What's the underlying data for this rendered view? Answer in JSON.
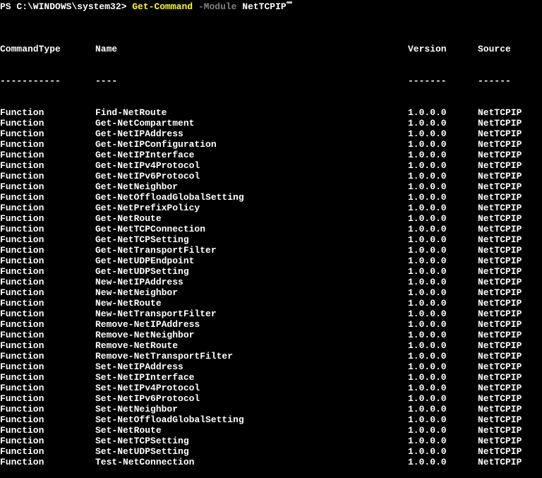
{
  "prompt": {
    "prefix": "PS C:\\WINDOWS\\system32> ",
    "command": "Get-Command",
    "flag": " -Module ",
    "arg": "NetTCPIP"
  },
  "headers": {
    "commandType": "CommandType",
    "name": "Name",
    "version": "Version",
    "source": "Source"
  },
  "separators": {
    "commandType": "-----------",
    "name": "----",
    "version": "-------",
    "source": "------"
  },
  "rows": [
    {
      "type": "Function",
      "name": "Find-NetRoute",
      "version": "1.0.0.0",
      "source": "NetTCPIP"
    },
    {
      "type": "Function",
      "name": "Get-NetCompartment",
      "version": "1.0.0.0",
      "source": "NetTCPIP"
    },
    {
      "type": "Function",
      "name": "Get-NetIPAddress",
      "version": "1.0.0.0",
      "source": "NetTCPIP"
    },
    {
      "type": "Function",
      "name": "Get-NetIPConfiguration",
      "version": "1.0.0.0",
      "source": "NetTCPIP"
    },
    {
      "type": "Function",
      "name": "Get-NetIPInterface",
      "version": "1.0.0.0",
      "source": "NetTCPIP"
    },
    {
      "type": "Function",
      "name": "Get-NetIPv4Protocol",
      "version": "1.0.0.0",
      "source": "NetTCPIP"
    },
    {
      "type": "Function",
      "name": "Get-NetIPv6Protocol",
      "version": "1.0.0.0",
      "source": "NetTCPIP"
    },
    {
      "type": "Function",
      "name": "Get-NetNeighbor",
      "version": "1.0.0.0",
      "source": "NetTCPIP"
    },
    {
      "type": "Function",
      "name": "Get-NetOffloadGlobalSetting",
      "version": "1.0.0.0",
      "source": "NetTCPIP"
    },
    {
      "type": "Function",
      "name": "Get-NetPrefixPolicy",
      "version": "1.0.0.0",
      "source": "NetTCPIP"
    },
    {
      "type": "Function",
      "name": "Get-NetRoute",
      "version": "1.0.0.0",
      "source": "NetTCPIP"
    },
    {
      "type": "Function",
      "name": "Get-NetTCPConnection",
      "version": "1.0.0.0",
      "source": "NetTCPIP"
    },
    {
      "type": "Function",
      "name": "Get-NetTCPSetting",
      "version": "1.0.0.0",
      "source": "NetTCPIP"
    },
    {
      "type": "Function",
      "name": "Get-NetTransportFilter",
      "version": "1.0.0.0",
      "source": "NetTCPIP"
    },
    {
      "type": "Function",
      "name": "Get-NetUDPEndpoint",
      "version": "1.0.0.0",
      "source": "NetTCPIP"
    },
    {
      "type": "Function",
      "name": "Get-NetUDPSetting",
      "version": "1.0.0.0",
      "source": "NetTCPIP"
    },
    {
      "type": "Function",
      "name": "New-NetIPAddress",
      "version": "1.0.0.0",
      "source": "NetTCPIP"
    },
    {
      "type": "Function",
      "name": "New-NetNeighbor",
      "version": "1.0.0.0",
      "source": "NetTCPIP"
    },
    {
      "type": "Function",
      "name": "New-NetRoute",
      "version": "1.0.0.0",
      "source": "NetTCPIP"
    },
    {
      "type": "Function",
      "name": "New-NetTransportFilter",
      "version": "1.0.0.0",
      "source": "NetTCPIP"
    },
    {
      "type": "Function",
      "name": "Remove-NetIPAddress",
      "version": "1.0.0.0",
      "source": "NetTCPIP"
    },
    {
      "type": "Function",
      "name": "Remove-NetNeighbor",
      "version": "1.0.0.0",
      "source": "NetTCPIP"
    },
    {
      "type": "Function",
      "name": "Remove-NetRoute",
      "version": "1.0.0.0",
      "source": "NetTCPIP"
    },
    {
      "type": "Function",
      "name": "Remove-NetTransportFilter",
      "version": "1.0.0.0",
      "source": "NetTCPIP"
    },
    {
      "type": "Function",
      "name": "Set-NetIPAddress",
      "version": "1.0.0.0",
      "source": "NetTCPIP"
    },
    {
      "type": "Function",
      "name": "Set-NetIPInterface",
      "version": "1.0.0.0",
      "source": "NetTCPIP"
    },
    {
      "type": "Function",
      "name": "Set-NetIPv4Protocol",
      "version": "1.0.0.0",
      "source": "NetTCPIP"
    },
    {
      "type": "Function",
      "name": "Set-NetIPv6Protocol",
      "version": "1.0.0.0",
      "source": "NetTCPIP"
    },
    {
      "type": "Function",
      "name": "Set-NetNeighbor",
      "version": "1.0.0.0",
      "source": "NetTCPIP"
    },
    {
      "type": "Function",
      "name": "Set-NetOffloadGlobalSetting",
      "version": "1.0.0.0",
      "source": "NetTCPIP"
    },
    {
      "type": "Function",
      "name": "Set-NetRoute",
      "version": "1.0.0.0",
      "source": "NetTCPIP"
    },
    {
      "type": "Function",
      "name": "Set-NetTCPSetting",
      "version": "1.0.0.0",
      "source": "NetTCPIP"
    },
    {
      "type": "Function",
      "name": "Set-NetUDPSetting",
      "version": "1.0.0.0",
      "source": "NetTCPIP"
    },
    {
      "type": "Function",
      "name": "Test-NetConnection",
      "version": "1.0.0.0",
      "source": "NetTCPIP"
    }
  ]
}
